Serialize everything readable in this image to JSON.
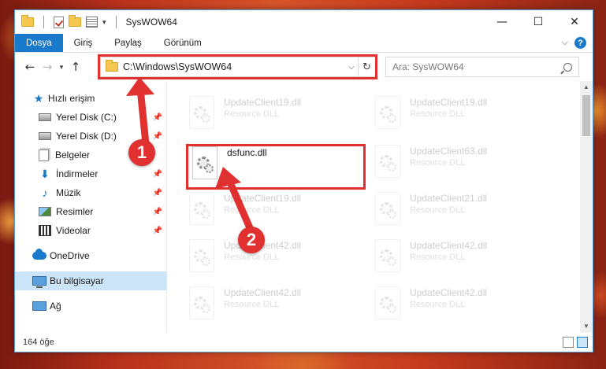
{
  "window": {
    "title": "SysWOW64",
    "minimize": "—",
    "maximize": "☐",
    "close": "✕"
  },
  "ribbon": {
    "tabs": [
      "Dosya",
      "Giriş",
      "Paylaş",
      "Görünüm"
    ],
    "help": "?"
  },
  "address": {
    "path": "C:\\Windows\\SysWOW64",
    "search_placeholder": "Ara: SysWOW64"
  },
  "sidebar": {
    "quick_access": "Hızlı erişim",
    "items": [
      {
        "label": "Yerel Disk (C:)",
        "icon": "drive-icon"
      },
      {
        "label": "Yerel Disk (D:)",
        "icon": "drive-icon"
      },
      {
        "label": "Belgeler",
        "icon": "documents-icon"
      },
      {
        "label": "İndirmeler",
        "icon": "downloads-icon"
      },
      {
        "label": "Müzik",
        "icon": "music-icon"
      },
      {
        "label": "Resimler",
        "icon": "pictures-icon"
      },
      {
        "label": "Videolar",
        "icon": "videos-icon"
      }
    ],
    "onedrive": "OneDrive",
    "this_pc": "Bu bilgisayar",
    "network": "Ağ"
  },
  "files": {
    "left": [
      {
        "name": "UpdateClient19.dll",
        "type": "Resource DLL"
      },
      {
        "name": "dsfunc.dll",
        "type": ""
      },
      {
        "name": "UpdateClient19.dll",
        "type": "Resource DLL"
      },
      {
        "name": "UpdateClient42.dll",
        "type": "Resource DLL"
      },
      {
        "name": "UpdateClient42.dll",
        "type": "Resource DLL"
      }
    ],
    "right": [
      {
        "name": "UpdateClient19.dll",
        "type": "Resource DLL"
      },
      {
        "name": "UpdateClient63.dll",
        "type": "Resource DLL"
      },
      {
        "name": "UpdateClient21.dll",
        "type": "Resource DLL"
      },
      {
        "name": "UpdateClient42.dll",
        "type": "Resource DLL"
      },
      {
        "name": "UpdateClient42.dll",
        "type": "Resource DLL"
      }
    ]
  },
  "status": {
    "count": "164 öğe"
  },
  "annotations": {
    "step1": "1",
    "step2": "2",
    "color": "#e03030"
  }
}
